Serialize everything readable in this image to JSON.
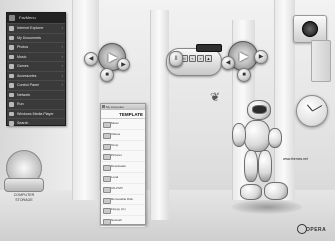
{
  "start_menu": {
    "header": "FavMenu",
    "items": [
      {
        "label": "Internet Explorer",
        "has_arrow": true
      },
      {
        "label": "My Documents",
        "has_arrow": false
      },
      {
        "label": "Photos",
        "has_arrow": true
      },
      {
        "label": "Music",
        "has_arrow": true
      },
      {
        "label": "Games",
        "has_arrow": true
      },
      {
        "label": "Accessories",
        "has_arrow": true
      },
      {
        "label": "Control Panel",
        "has_arrow": true
      },
      {
        "label": "Network",
        "has_arrow": false
      },
      {
        "label": "Run",
        "has_arrow": false
      },
      {
        "label": "Windows Media Player",
        "has_arrow": false
      },
      {
        "label": "Search",
        "has_arrow": false
      }
    ]
  },
  "explorer": {
    "title": "My Computer",
    "header": "TEMPLATE",
    "items": [
      "Music",
      "Videos",
      "Temp",
      "Pictures",
      "Downloads",
      "Local",
      "CD-DVD",
      "Removable Disk",
      "Floppy (A:)",
      "Network"
    ]
  },
  "media_player": {
    "lcd_text": "00:00"
  },
  "desktop": {
    "drive_label": "COMPUTER\nSTORAGE",
    "website": "www.themes.net",
    "brand": "OPERA"
  },
  "icons": {
    "play": "play-icon",
    "stop": "stop-icon",
    "prev": "previous-icon",
    "next": "next-icon",
    "camera": "webcam-icon",
    "clock": "clock-icon",
    "butterfly": "butterfly-icon",
    "robot": "robot-mascot"
  },
  "colors": {
    "menu_bg": "#3a3a3a",
    "desktop_bg": "#e6e6e6",
    "panel_bg": "#f8f8f8"
  }
}
